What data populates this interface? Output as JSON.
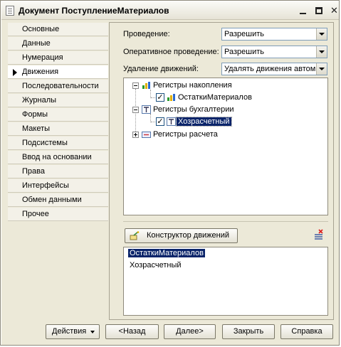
{
  "window": {
    "title": "Документ ПоступлениеМатериалов"
  },
  "nav": {
    "items": [
      {
        "label": "Основные"
      },
      {
        "label": "Данные"
      },
      {
        "label": "Нумерация"
      },
      {
        "label": "Движения",
        "active": true
      },
      {
        "label": "Последовательности"
      },
      {
        "label": "Журналы"
      },
      {
        "label": "Формы"
      },
      {
        "label": "Макеты"
      },
      {
        "label": "Подсистемы"
      },
      {
        "label": "Ввод на основании"
      },
      {
        "label": "Права"
      },
      {
        "label": "Интерфейсы"
      },
      {
        "label": "Обмен данными"
      },
      {
        "label": "Прочее"
      }
    ]
  },
  "fields": {
    "posting_label": "Проведение:",
    "posting_value": "Разрешить",
    "realtime_label": "Оперативное проведение:",
    "realtime_value": "Разрешить",
    "delete_label": "Удаление движений:",
    "delete_value": "Удалять движения автом"
  },
  "tree": {
    "accumulation": "Регистры накопления",
    "accumulation_child": "ОстаткиМатериалов",
    "accounting": "Регистры бухгалтерии",
    "accounting_child": "Хозрасчетный",
    "calculation": "Регистры расчета",
    "check_mark": "✓"
  },
  "constructor_button": "Конструктор движений",
  "movements_list": [
    {
      "label": "ОстаткиМатериалов",
      "selected": true
    },
    {
      "label": "Хозрасчетный"
    }
  ],
  "buttons": {
    "actions": "Действия",
    "back": "<Назад",
    "next": "Далее>",
    "close": "Закрыть",
    "help": "Справка"
  },
  "colors": {
    "selection": "#0a246a",
    "window_bg": "#ece9d8"
  }
}
